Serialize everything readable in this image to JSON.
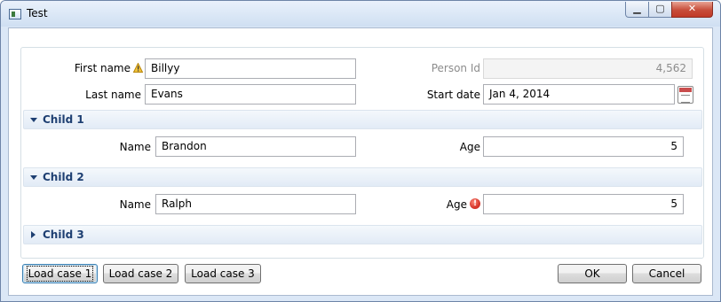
{
  "window": {
    "title": "Test"
  },
  "title_buttons": {
    "minimize": "▁",
    "maximize": "▢",
    "close": "✕"
  },
  "form": {
    "first_name": {
      "label": "First name",
      "value": "Billyy"
    },
    "last_name": {
      "label": "Last name",
      "value": "Evans"
    },
    "person_id": {
      "label": "Person Id",
      "value": "4,562"
    },
    "start_date": {
      "label": "Start date",
      "value": "Jan 4, 2014"
    }
  },
  "children": [
    {
      "header": "Child 1",
      "name_label": "Name",
      "name_value": "Brandon",
      "age_label": "Age",
      "age_value": "5"
    },
    {
      "header": "Child 2",
      "name_label": "Name",
      "name_value": "Ralph",
      "age_label": "Age",
      "age_value": "5",
      "age_error_icon": "!"
    },
    {
      "header": "Child 3"
    }
  ],
  "buttons": {
    "load1": "Load case 1",
    "load2": "Load case 2",
    "load3": "Load case 3",
    "ok": "OK",
    "cancel": "Cancel"
  }
}
